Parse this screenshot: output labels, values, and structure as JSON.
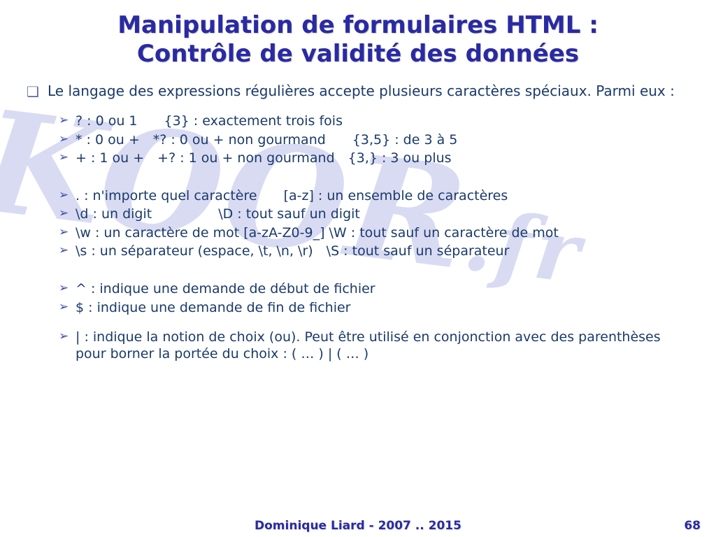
{
  "watermark": {
    "main": "KOOR",
    "suffix": ".fr"
  },
  "title": {
    "line1": "Manipulation de formulaires HTML :",
    "line2": "Contrôle de validité des données"
  },
  "intro": "Le langage des expressions régulières accepte plusieurs caractères spéciaux. Parmi eux :",
  "group1": [
    "? : 0 ou 1  {3} : exactement trois fois",
    "* : 0 ou + *? : 0 ou + non gourmand  {3,5} : de 3 à 5",
    "+ : 1 ou + +? : 1 ou + non gourmand {3,} : 3 ou plus"
  ],
  "group2": [
    ". : n'importe quel caractère  [a-z] : un ensemble de caractères",
    "\\d : un digit     \\D : tout sauf un digit",
    "\\w : un caractère de mot [a-zA-Z0-9_] \\W : tout sauf un caractère de mot",
    "\\s : un séparateur (espace, \\t, \\n, \\r) \\S : tout sauf un séparateur"
  ],
  "group3": [
    "^ : indique une demande de début de fichier",
    "$ : indique une demande de fin de fichier"
  ],
  "group4": [
    "| : indique la notion de choix (ou). Peut être utilisé en conjonction avec des parenthèses pour borner la portée du choix : ( … ) | ( … )"
  ],
  "footer": {
    "author": "Dominique Liard - 2007 .. 2015",
    "page": "68"
  }
}
